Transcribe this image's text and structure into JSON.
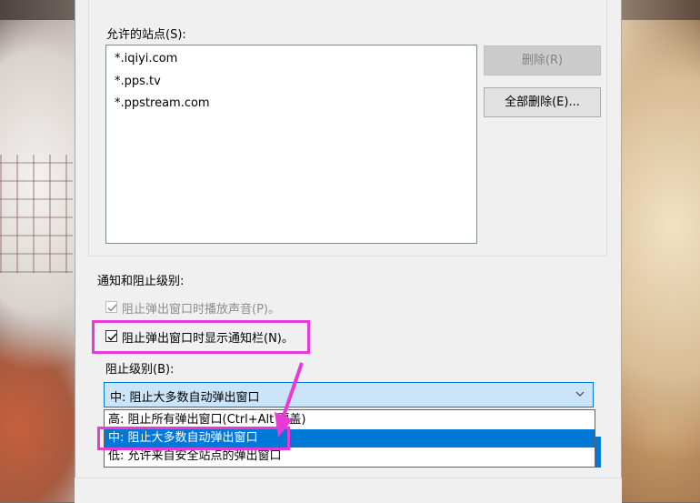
{
  "allowed_sites": {
    "label": "允许的站点(S):",
    "items": [
      "*.iqiyi.com",
      "*.pps.tv",
      "*.ppstream.com"
    ],
    "delete_label": "删除(R)",
    "delete_all_label": "全部删除(E)..."
  },
  "notify": {
    "group_label": "通知和阻止级别:",
    "play_sound_label": "阻止弹出窗口时播放声音(P)。",
    "play_sound_checked": true,
    "show_bar_label": "阻止弹出窗口时显示通知栏(N)。",
    "show_bar_checked": true,
    "level_label": "阻止级别(B):",
    "level_selected": "中: 阻止大多数自动弹出窗口",
    "level_options": [
      "高: 阻止所有弹出窗口(Ctrl+Alt 覆盖)",
      "中: 阻止大多数自动弹出窗口",
      "低: 允许来自安全站点的弹出窗口"
    ]
  },
  "colors": {
    "accent": "#0078d7",
    "highlight_annotation": "#e83ad6"
  },
  "icons": {
    "checkbox": "checkmark-icon",
    "dropdown": "chevron-down-icon",
    "annotation": "pointer-arrow-icon"
  }
}
